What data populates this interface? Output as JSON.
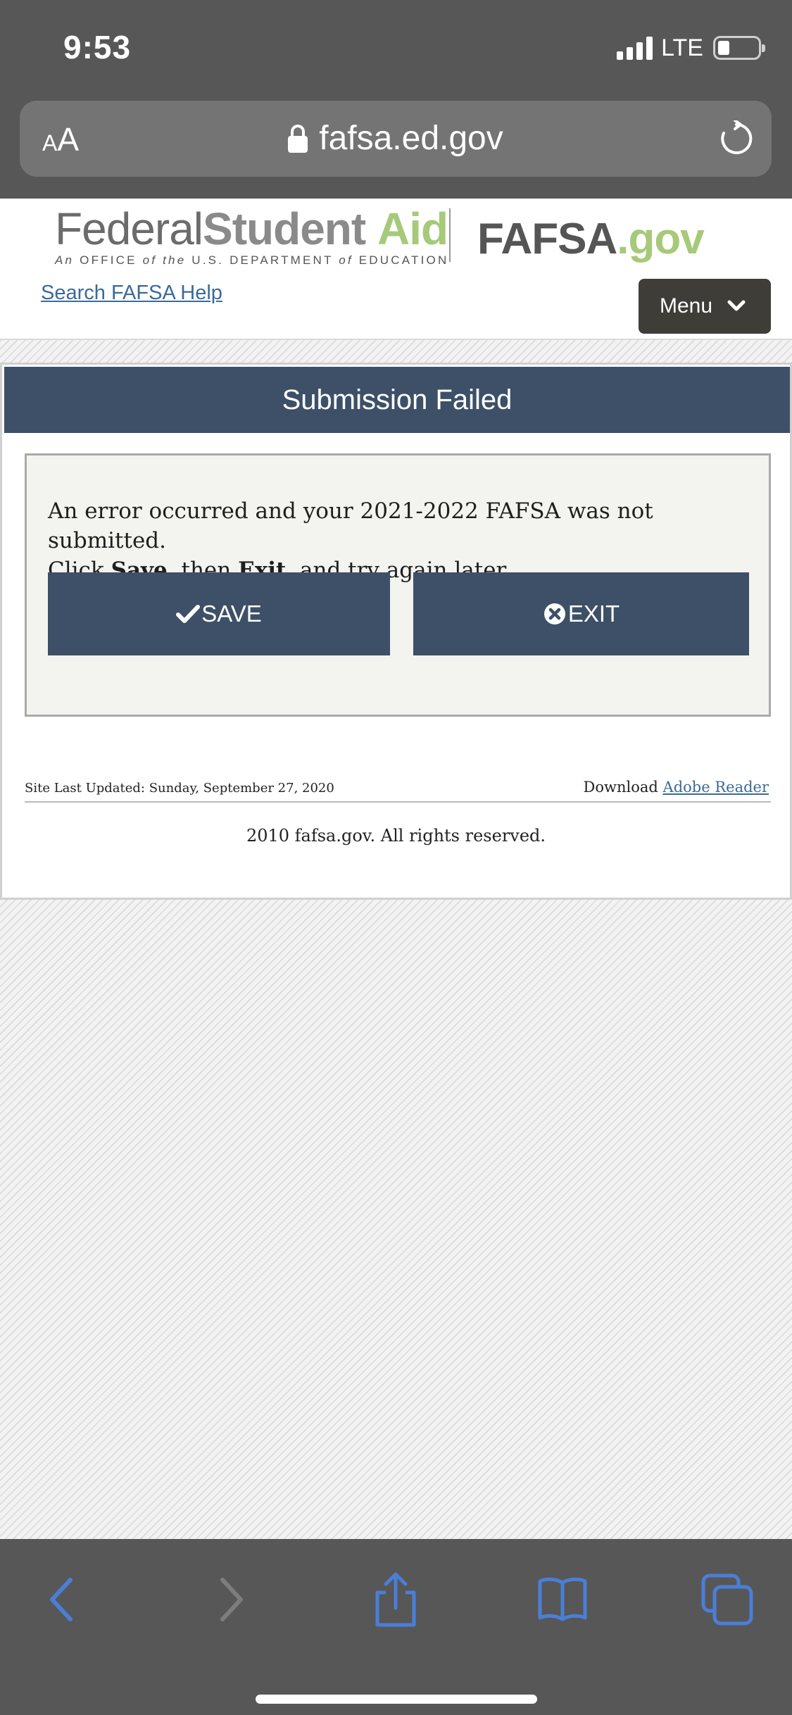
{
  "status_bar": {
    "time": "9:53",
    "network": "LTE"
  },
  "browser": {
    "text_size_label_small": "A",
    "text_size_label_big": "A",
    "url": "fafsa.ed.gov"
  },
  "site_header": {
    "fsa_logo": {
      "word1": "Federal",
      "word2": "Student",
      "word3": "Aid",
      "tagline_1": "An",
      "tagline_2": "OFFICE",
      "tagline_3": "of the",
      "tagline_4": "U.S. DEPARTMENT",
      "tagline_5": "of",
      "tagline_6": "EDUCATION"
    },
    "fafsa_logo": {
      "main": "FAFSA",
      "suffix": ".gov"
    },
    "search_link": "Search FAFSA Help",
    "menu_label": "Menu"
  },
  "main": {
    "title": "Submission Failed",
    "message_line1": "An error occurred and your 2021-2022 FAFSA was not submitted.",
    "message_click": "Click ",
    "message_save": "Save",
    "message_then": ", then ",
    "message_exit": "Exit",
    "message_end": ", and try again later.",
    "save_button": "SAVE",
    "exit_button": "EXIT"
  },
  "footer": {
    "site_updated": "Site Last Updated: Sunday, September 27, 2020",
    "download_prefix": "Download ",
    "download_link": "Adobe Reader",
    "copyright": "2010 fafsa.gov. All rights reserved."
  },
  "toolbar": {
    "icons": [
      "back-icon",
      "forward-icon",
      "share-icon",
      "bookmarks-icon",
      "tabs-icon"
    ]
  },
  "colors": {
    "brand_navy": "#3d5068",
    "brand_green": "#a7c97a",
    "ios_chrome": "#575757",
    "ios_tint": "#4a7fd8"
  }
}
